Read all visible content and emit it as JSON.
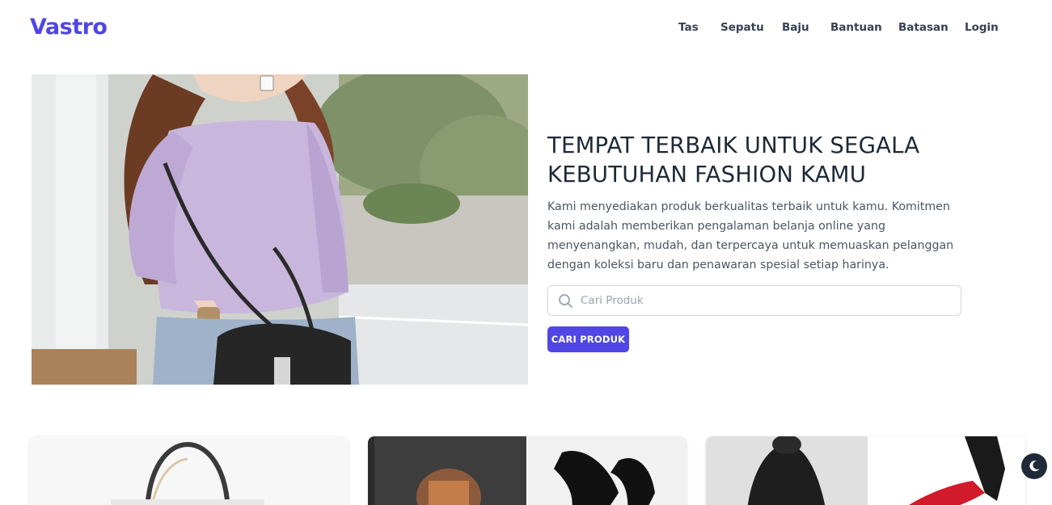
{
  "brand": {
    "logo_text": "Vastro",
    "accent_color": "#4f46e5"
  },
  "nav": {
    "items": [
      {
        "label": "Tas"
      },
      {
        "label": "Sepatu"
      },
      {
        "label": "Baju"
      },
      {
        "label": "Bantuan"
      },
      {
        "label": "Batasan"
      },
      {
        "label": "Login"
      }
    ]
  },
  "hero": {
    "title": "TEMPAT TERBAIK UNTUK SEGALA KEBUTUHAN FASHION KAMU",
    "description": "Kami menyediakan produk berkualitas terbaik untuk kamu. Komitmen kami adalah memberikan pengalaman belanja online yang menyenangkan, mudah, dan terpercaya untuk memuaskan pelanggan dengan koleksi baru dan penawaran spesial setiap harinya.",
    "search": {
      "placeholder": "Cari Produk",
      "icon": "search-icon"
    },
    "cta_label": "CARI PRODUK"
  },
  "theme_toggle": {
    "icon": "moon-icon"
  }
}
